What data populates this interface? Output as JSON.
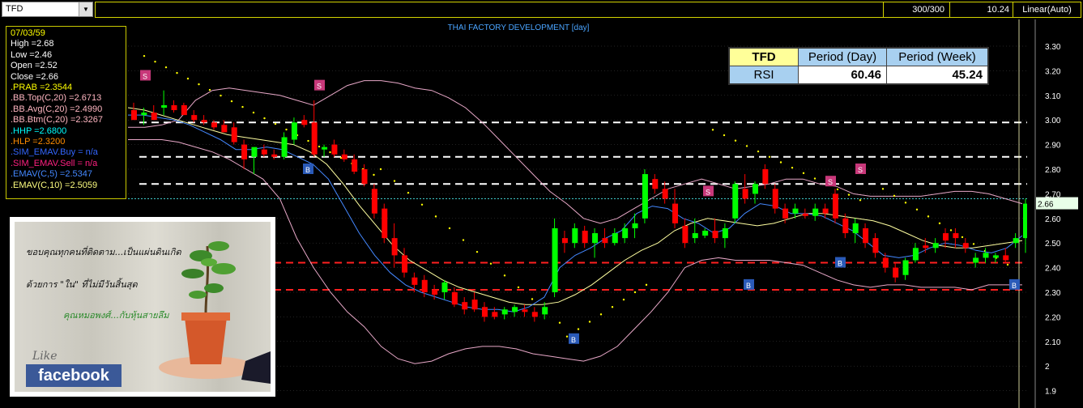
{
  "toolbar": {
    "symbol": "TFD",
    "bars": "300/300",
    "last": "10.24",
    "scale": "Linear(Auto)"
  },
  "colors": {
    "up": "#00ff00",
    "down": "#ff0000",
    "bb": "#e8a8c8",
    "ema5": "#4488ff",
    "ema10": "#ffffa0",
    "sar": "#ffff00",
    "grid": "#444444"
  },
  "info": {
    "date": "07/03/59",
    "high": "High  =2.68",
    "low": "Low   =2.46",
    "open": "Open  =2.52",
    "close": "Close =2.66",
    "prab": ".PRAB   =2.3544",
    "bbtop": ".BB.Top(C,20)   =2.6713",
    "bbavg": ".BB.Avg(C,20)   =2.4990",
    "bbbtm": ".BB.Btm(C,20)  =2.3267",
    "hhp": ".HHP    =2.6800",
    "hlp": ".HLP    =2.3200",
    "simbuy": ".SIM_EMAV.Buy   = n/a",
    "simsell": ".SIM_EMAV.Sell   = n/a",
    "emav5": ".EMAV(C,5)   =2.5347",
    "emav10": ".EMAV(C,10)  =2.5059"
  },
  "rsi_table": {
    "header": [
      "TFD",
      "Period (Day)",
      "Period (Week)"
    ],
    "row_label": "RSI",
    "day": "60.46",
    "week": "45.24"
  },
  "ad": {
    "line1": "ขอบคุณทุกคนที่ติดตาม...เป็นแผ่นดินเกิด",
    "line2": "ด้วยการ \"ใน\" ที่ไม่มีวันสิ้นสุด",
    "line3": "คุณหมอพงศ์...กับหุ้นสายลึม",
    "like": "Like",
    "fb": "facebook"
  },
  "chart_data": {
    "type": "candlestick",
    "title": "THAI FACTORY DEVELOPMENT [day]",
    "y_ticks": [
      "3.30",
      "3.20",
      "3.10",
      "3.00",
      "2.90",
      "2.80",
      "2.70",
      "2.60",
      "2.50",
      "2.40",
      "2.30",
      "2.20",
      "2.10",
      "2",
      "1.9"
    ],
    "ylim": [
      1.85,
      3.35
    ],
    "last_price_label": "2.66",
    "white_levels": [
      2.99,
      2.85,
      2.74
    ],
    "red_levels": [
      2.42,
      2.31
    ],
    "cyan_level": 2.68,
    "candles": [
      [
        3.04,
        3.07,
        3.01,
        3.0
      ],
      [
        3.02,
        3.05,
        2.98,
        3.03
      ],
      [
        3.03,
        3.06,
        3.0,
        3.0
      ],
      [
        3.05,
        3.12,
        3.02,
        3.06
      ],
      [
        3.06,
        3.08,
        3.03,
        3.04
      ],
      [
        3.06,
        3.07,
        3.02,
        3.02
      ],
      [
        3.02,
        3.04,
        2.99,
        3.0
      ],
      [
        3.0,
        3.02,
        2.98,
        2.99
      ],
      [
        2.99,
        3.0,
        2.96,
        2.97
      ],
      [
        2.98,
        3.0,
        2.95,
        2.95
      ],
      [
        2.97,
        2.99,
        2.9,
        2.91
      ],
      [
        2.9,
        2.92,
        2.8,
        2.84
      ],
      [
        2.85,
        2.88,
        2.78,
        2.89
      ],
      [
        2.88,
        2.9,
        2.85,
        2.86
      ],
      [
        2.86,
        2.88,
        2.84,
        2.85
      ],
      [
        2.85,
        2.95,
        2.84,
        2.93
      ],
      [
        2.92,
        3.01,
        2.9,
        2.99
      ],
      [
        3.0,
        3.02,
        2.97,
        2.98
      ],
      [
        2.99,
        3.08,
        2.85,
        2.86
      ],
      [
        2.88,
        2.9,
        2.85,
        2.89
      ],
      [
        2.9,
        2.92,
        2.85,
        2.86
      ],
      [
        2.86,
        2.88,
        2.83,
        2.84
      ],
      [
        2.84,
        2.86,
        2.78,
        2.79
      ],
      [
        2.8,
        2.82,
        2.73,
        2.74
      ],
      [
        2.72,
        2.74,
        2.6,
        2.62
      ],
      [
        2.64,
        2.66,
        2.5,
        2.52
      ],
      [
        2.52,
        2.58,
        2.4,
        2.45
      ],
      [
        2.45,
        2.48,
        2.36,
        2.38
      ],
      [
        2.36,
        2.38,
        2.3,
        2.33
      ],
      [
        2.35,
        2.37,
        2.28,
        2.3
      ],
      [
        2.31,
        2.33,
        2.27,
        2.29
      ],
      [
        2.3,
        2.35,
        2.27,
        2.34
      ],
      [
        2.3,
        2.32,
        2.24,
        2.25
      ],
      [
        2.26,
        2.28,
        2.21,
        2.23
      ],
      [
        2.27,
        2.3,
        2.22,
        2.23
      ],
      [
        2.24,
        2.26,
        2.18,
        2.2
      ],
      [
        2.22,
        2.24,
        2.19,
        2.2
      ],
      [
        2.21,
        2.24,
        2.19,
        2.23
      ],
      [
        2.22,
        2.25,
        2.2,
        2.24
      ],
      [
        2.23,
        2.25,
        2.2,
        2.22
      ],
      [
        2.22,
        2.24,
        2.18,
        2.2
      ],
      [
        2.21,
        2.26,
        2.19,
        2.24
      ],
      [
        2.3,
        2.6,
        2.28,
        2.56
      ],
      [
        2.52,
        2.55,
        2.46,
        2.5
      ],
      [
        2.5,
        2.58,
        2.48,
        2.56
      ],
      [
        2.55,
        2.57,
        2.48,
        2.5
      ],
      [
        2.5,
        2.56,
        2.44,
        2.54
      ],
      [
        2.52,
        2.56,
        2.48,
        2.5
      ],
      [
        2.5,
        2.56,
        2.49,
        2.54
      ],
      [
        2.52,
        2.58,
        2.5,
        2.56
      ],
      [
        2.56,
        2.62,
        2.52,
        2.58
      ],
      [
        2.6,
        2.8,
        2.58,
        2.78
      ],
      [
        2.76,
        2.78,
        2.7,
        2.72
      ],
      [
        2.72,
        2.75,
        2.66,
        2.68
      ],
      [
        2.66,
        2.72,
        2.56,
        2.58
      ],
      [
        2.57,
        2.6,
        2.48,
        2.5
      ],
      [
        2.52,
        2.6,
        2.5,
        2.54
      ],
      [
        2.53,
        2.56,
        2.52,
        2.55
      ],
      [
        2.55,
        2.6,
        2.5,
        2.52
      ],
      [
        2.52,
        2.58,
        2.48,
        2.56
      ],
      [
        2.6,
        2.75,
        2.58,
        2.74
      ],
      [
        2.72,
        2.78,
        2.66,
        2.68
      ],
      [
        2.7,
        2.75,
        2.66,
        2.74
      ],
      [
        2.8,
        2.82,
        2.72,
        2.74
      ],
      [
        2.72,
        2.74,
        2.62,
        2.64
      ],
      [
        2.64,
        2.66,
        2.58,
        2.6
      ],
      [
        2.62,
        2.66,
        2.6,
        2.64
      ],
      [
        2.62,
        2.64,
        2.6,
        2.61
      ],
      [
        2.61,
        2.66,
        2.59,
        2.64
      ],
      [
        2.64,
        2.66,
        2.6,
        2.62
      ],
      [
        2.7,
        2.72,
        2.58,
        2.6
      ],
      [
        2.6,
        2.62,
        2.52,
        2.54
      ],
      [
        2.54,
        2.6,
        2.5,
        2.58
      ],
      [
        2.56,
        2.58,
        2.48,
        2.5
      ],
      [
        2.52,
        2.54,
        2.44,
        2.46
      ],
      [
        2.44,
        2.46,
        2.38,
        2.4
      ],
      [
        2.4,
        2.42,
        2.34,
        2.36
      ],
      [
        2.37,
        2.44,
        2.35,
        2.43
      ],
      [
        2.43,
        2.5,
        2.42,
        2.48
      ],
      [
        2.49,
        2.52,
        2.46,
        2.48
      ],
      [
        2.48,
        2.52,
        2.46,
        2.5
      ],
      [
        2.54,
        2.56,
        2.48,
        2.51
      ],
      [
        2.54,
        2.56,
        2.48,
        2.52
      ],
      [
        2.5,
        2.52,
        2.46,
        2.48
      ],
      [
        2.42,
        2.46,
        2.4,
        2.44
      ],
      [
        2.44,
        2.48,
        2.42,
        2.46
      ],
      [
        2.44,
        2.46,
        2.42,
        2.45
      ],
      [
        2.45,
        2.48,
        2.42,
        2.43
      ],
      [
        2.5,
        2.54,
        2.48,
        2.52
      ],
      [
        2.52,
        2.68,
        2.46,
        2.66
      ]
    ],
    "bb_top": [
      2.97,
      2.97,
      2.98,
      3.0,
      3.08,
      3.12,
      3.13,
      3.12,
      3.11,
      3.1,
      3.08,
      3.06,
      3.1,
      3.14,
      3.16,
      3.16,
      3.15,
      3.13,
      3.12,
      3.09,
      3.05,
      2.99,
      2.92,
      2.85,
      2.78,
      2.71,
      2.66,
      2.6,
      2.58,
      2.6,
      2.64,
      2.68,
      2.72,
      2.74,
      2.76,
      2.74,
      2.72,
      2.73,
      2.74,
      2.76,
      2.76,
      2.74,
      2.73,
      2.7,
      2.69,
      2.69,
      2.69,
      2.69,
      2.7,
      2.71,
      2.71,
      2.7,
      2.68,
      2.66
    ],
    "bb_bot": [
      2.92,
      2.92,
      2.92,
      2.91,
      2.89,
      2.87,
      2.84,
      2.8,
      2.76,
      2.68,
      2.52,
      2.4,
      2.3,
      2.22,
      2.16,
      2.08,
      2.03,
      2.01,
      2.02,
      2.05,
      2.07,
      2.08,
      2.08,
      2.07,
      2.05,
      2.04,
      2.03,
      2.02,
      2.04,
      2.08,
      2.15,
      2.22,
      2.3,
      2.4,
      2.43,
      2.44,
      2.43,
      2.43,
      2.43,
      2.42,
      2.41,
      2.38,
      2.35,
      2.33,
      2.32,
      2.33,
      2.33,
      2.32,
      2.32,
      2.32,
      2.31,
      2.33,
      2.33,
      2.33
    ],
    "ema5": [
      3.02,
      3.02,
      3.01,
      3.0,
      2.98,
      2.95,
      2.92,
      2.88,
      2.88,
      2.89,
      2.88,
      2.85,
      2.82,
      2.76,
      2.65,
      2.54,
      2.45,
      2.38,
      2.33,
      2.3,
      2.28,
      2.26,
      2.24,
      2.23,
      2.23,
      2.22,
      2.24,
      2.28,
      2.4,
      2.45,
      2.48,
      2.52,
      2.55,
      2.62,
      2.65,
      2.64,
      2.6,
      2.58,
      2.54,
      2.56,
      2.62,
      2.66,
      2.65,
      2.62,
      2.62,
      2.61,
      2.58,
      2.55,
      2.5,
      2.45,
      2.44,
      2.45,
      2.48,
      2.5,
      2.49,
      2.47,
      2.46,
      2.48,
      2.53
    ],
    "ema10": [
      3.05,
      3.04,
      3.02,
      3.0,
      2.98,
      2.96,
      2.94,
      2.93,
      2.92,
      2.91,
      2.9,
      2.87,
      2.82,
      2.74,
      2.65,
      2.57,
      2.49,
      2.43,
      2.39,
      2.35,
      2.32,
      2.3,
      2.28,
      2.26,
      2.25,
      2.25,
      2.26,
      2.29,
      2.33,
      2.38,
      2.43,
      2.47,
      2.5,
      2.55,
      2.58,
      2.6,
      2.59,
      2.58,
      2.57,
      2.58,
      2.6,
      2.62,
      2.62,
      2.61,
      2.6,
      2.59,
      2.57,
      2.54,
      2.51,
      2.49,
      2.48,
      2.48,
      2.49,
      2.5,
      2.51
    ]
  }
}
